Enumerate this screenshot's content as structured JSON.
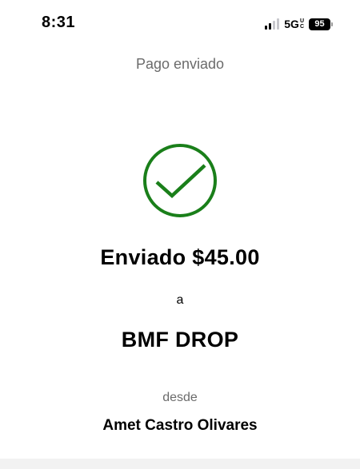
{
  "status_bar": {
    "time": "8:31",
    "network": "5G",
    "network_sub_top": "U",
    "network_sub_bottom": "C",
    "battery": "95",
    "signal_bars_active": 2,
    "signal_bars_total": 4
  },
  "header": {
    "title": "Pago enviado"
  },
  "confirmation": {
    "check_color": "#1a7f1a",
    "amount_line": "Enviado $45.00",
    "connector": "a",
    "recipient": "BMF DROP",
    "from_label": "desde",
    "sender": "Amet Castro Olivares"
  }
}
